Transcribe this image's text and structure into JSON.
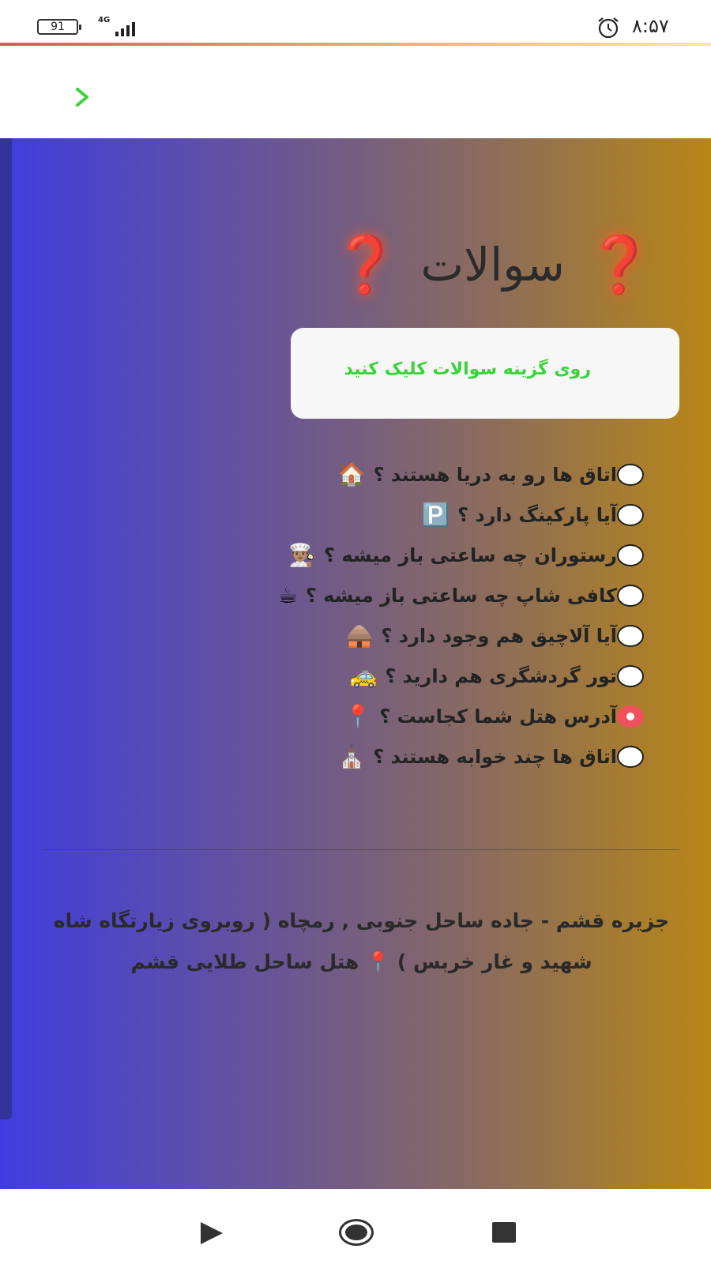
{
  "status_bar": {
    "battery": "91",
    "network": "4G",
    "time": "۸:۵۷"
  },
  "header": {
    "back_icon": "chevron-right-icon",
    "back_color": "#3ad33a"
  },
  "main": {
    "title": "سوالات",
    "title_mark": "❓",
    "info_text": "روی گزینه سوالات کلیک کنید",
    "options": [
      {
        "label": "اتاق ها رو به دریا هستند ؟",
        "emoji": "🏠",
        "checked": false
      },
      {
        "label": "آیا پارکینگ دارد ؟",
        "emoji": "🅿️",
        "checked": false
      },
      {
        "label": "رستوران چه ساعتی باز میشه ؟",
        "emoji": "👨🏽‍🍳",
        "checked": false
      },
      {
        "label": "کافی شاپ چه ساعتی باز میشه ؟",
        "emoji": "☕",
        "checked": false
      },
      {
        "label": "آیا آلاچیق هم وجود دارد ؟",
        "emoji": "🛖",
        "checked": false
      },
      {
        "label": "تور گردشگری هم دارید ؟",
        "emoji": "🚕",
        "checked": false
      },
      {
        "label": "آدرس هتل شما کجاست ؟",
        "emoji": "📍",
        "checked": true
      },
      {
        "label": "اتاق ها چند خوابه هستند ؟",
        "emoji": "⛪",
        "checked": false
      }
    ],
    "answer_line1": "جزیره قشم - جاده ساحل جنوبی , رمچاه ( روبروی زیارتگاه شاه",
    "answer_line2": "شهید و غار خربس ) 📍 هتل ساحل طلایی قشم"
  },
  "colors": {
    "accent_green": "#3ad33a",
    "radio_selected": "#f0505c",
    "gradient_left": "#3f3de0",
    "gradient_right": "#b88617"
  },
  "nav_bar": {
    "icons": [
      "back-triangle-icon",
      "home-circle-icon",
      "recent-square-icon"
    ]
  }
}
